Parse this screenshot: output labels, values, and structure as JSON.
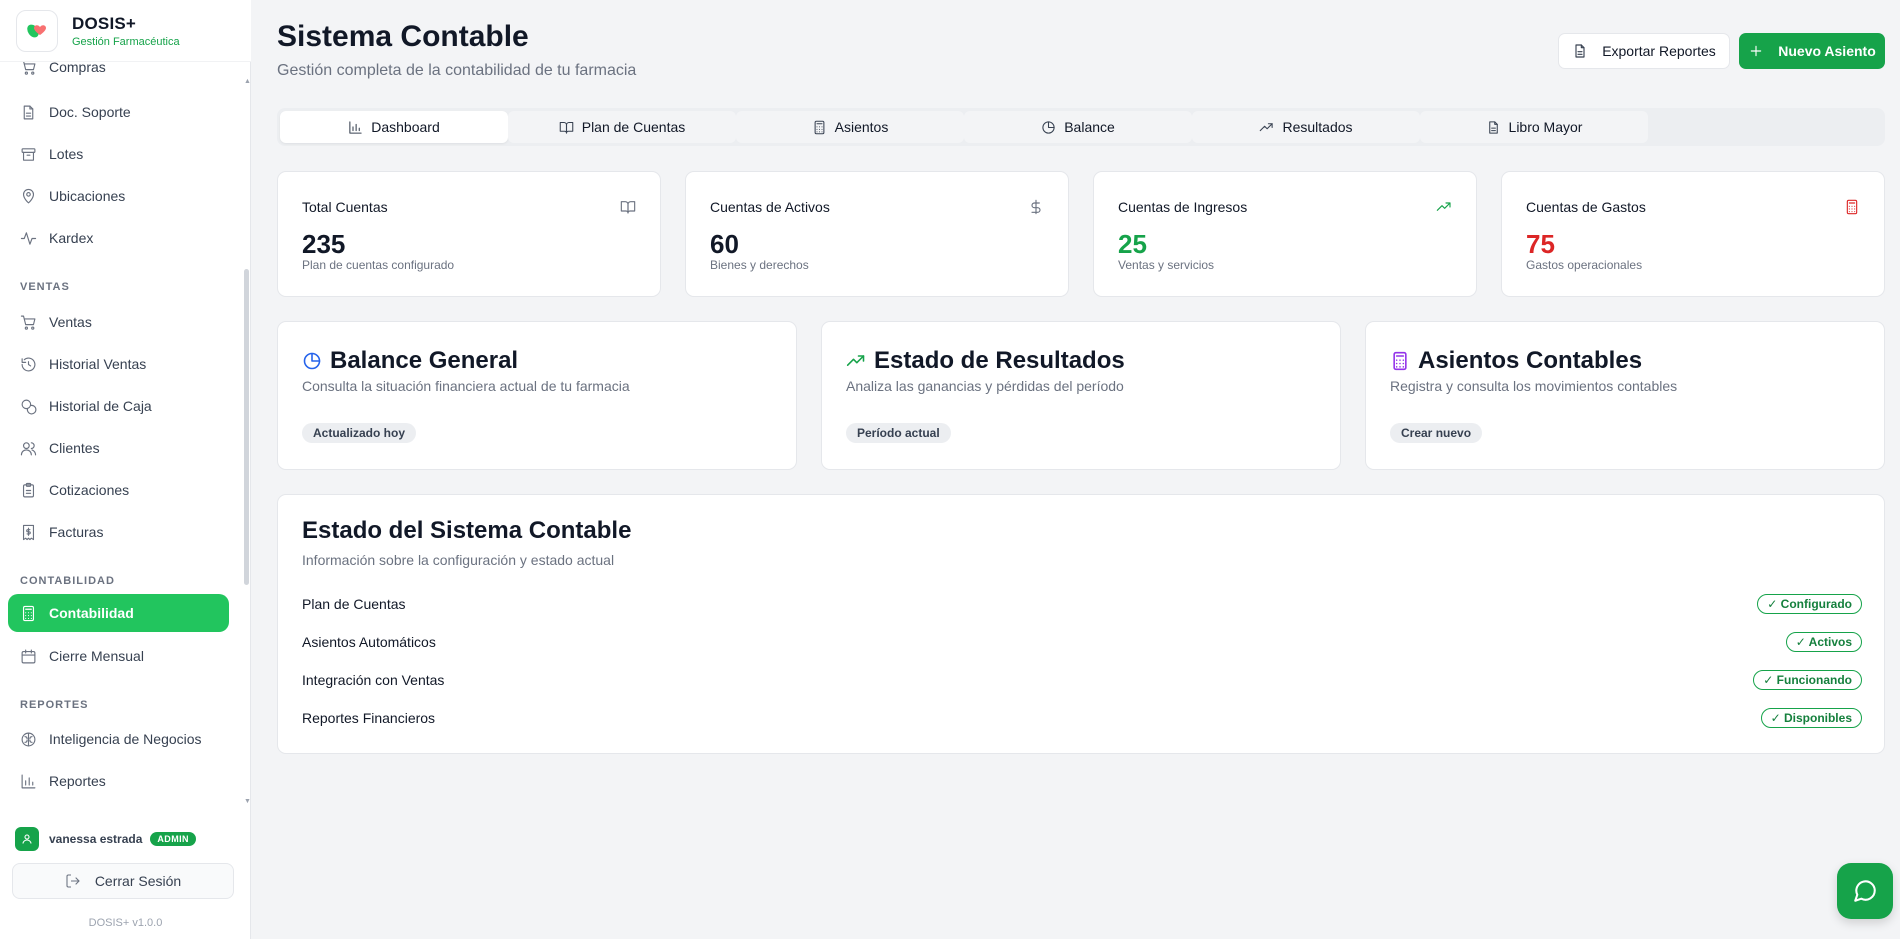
{
  "brand": {
    "name": "DOSIS+",
    "subtitle": "Gestión Farmacéutica"
  },
  "sidebar": {
    "items": [
      {
        "label": "Compras",
        "icon": "cart-icon"
      },
      {
        "label": "Doc. Soporte",
        "icon": "document-icon"
      },
      {
        "label": "Lotes",
        "icon": "archive-icon"
      },
      {
        "label": "Ubicaciones",
        "icon": "map-pin-icon"
      },
      {
        "label": "Kardex",
        "icon": "activity-icon"
      },
      {
        "label": "Ventas",
        "icon": "cart-icon"
      },
      {
        "label": "Historial Ventas",
        "icon": "history-icon"
      },
      {
        "label": "Historial de Caja",
        "icon": "coins-icon"
      },
      {
        "label": "Clientes",
        "icon": "users-icon"
      },
      {
        "label": "Cotizaciones",
        "icon": "clipboard-icon"
      },
      {
        "label": "Facturas",
        "icon": "receipt-icon"
      },
      {
        "label": "Contabilidad",
        "icon": "calculator-icon"
      },
      {
        "label": "Cierre Mensual",
        "icon": "calendar-icon"
      },
      {
        "label": "Inteligencia de Negocios",
        "icon": "brain-icon"
      },
      {
        "label": "Reportes",
        "icon": "bar-chart-icon"
      }
    ],
    "sections": {
      "ventas": "VENTAS",
      "contabilidad": "CONTABILIDAD",
      "reportes": "REPORTES"
    },
    "active": "Contabilidad"
  },
  "user": {
    "name": "vanessa estrada",
    "role": "ADMIN"
  },
  "logout_label": "Cerrar Sesión",
  "version": "DOSIS+ v1.0.0",
  "header": {
    "title": "Sistema Contable",
    "subtitle": "Gestión completa de la contabilidad de tu farmacia",
    "export_label": "Exportar Reportes",
    "new_label": "Nuevo Asiento"
  },
  "tabs": [
    {
      "label": "Dashboard",
      "icon": "bar-chart-icon",
      "active": true
    },
    {
      "label": "Plan de Cuentas",
      "icon": "book-open-icon",
      "active": false
    },
    {
      "label": "Asientos",
      "icon": "calculator-icon",
      "active": false
    },
    {
      "label": "Balance",
      "icon": "pie-chart-icon",
      "active": false
    },
    {
      "label": "Resultados",
      "icon": "trending-up-icon",
      "active": false
    },
    {
      "label": "Libro Mayor",
      "icon": "file-text-icon",
      "active": false
    }
  ],
  "stats": [
    {
      "label": "Total Cuentas",
      "value": "235",
      "desc": "Plan de cuentas configurado",
      "icon": "book-open-icon",
      "color": "#111827"
    },
    {
      "label": "Cuentas de Activos",
      "value": "60",
      "desc": "Bienes y derechos",
      "icon": "dollar-icon",
      "color": "#111827"
    },
    {
      "label": "Cuentas de Ingresos",
      "value": "25",
      "desc": "Ventas y servicios",
      "icon": "trending-up-icon",
      "color": "#16a34a"
    },
    {
      "label": "Cuentas de Gastos",
      "value": "75",
      "desc": "Gastos operacionales",
      "icon": "calculator-icon",
      "color": "#dc2626"
    }
  ],
  "features": [
    {
      "title": "Balance General",
      "desc": "Consulta la situación financiera actual de tu farmacia",
      "chip": "Actualizado hoy",
      "icon": "pie-chart-icon",
      "color": "#2563eb"
    },
    {
      "title": "Estado de Resultados",
      "desc": "Analiza las ganancias y pérdidas del período",
      "chip": "Período actual",
      "icon": "trending-up-icon",
      "color": "#16a34a"
    },
    {
      "title": "Asientos Contables",
      "desc": "Registra y consulta los movimientos contables",
      "chip": "Crear nuevo",
      "icon": "calculator-icon",
      "color": "#9333ea"
    }
  ],
  "system_status": {
    "title": "Estado del Sistema Contable",
    "subtitle": "Información sobre la configuración y estado actual",
    "rows": [
      {
        "name": "Plan de Cuentas",
        "status": "✓ Configurado"
      },
      {
        "name": "Asientos Automáticos",
        "status": "✓ Activos"
      },
      {
        "name": "Integración con Ventas",
        "status": "✓ Funcionando"
      },
      {
        "name": "Reportes Financieros",
        "status": "✓ Disponibles"
      }
    ]
  },
  "colors": {
    "accent": "#16a34a",
    "active_nav": "#22c55e",
    "danger": "#dc2626",
    "info": "#2563eb",
    "purple": "#9333ea"
  }
}
